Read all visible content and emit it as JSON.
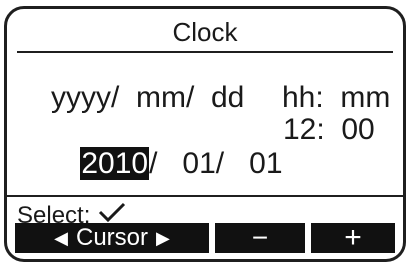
{
  "screen": {
    "title": "Clock",
    "header": {
      "date": "yyyy/  mm/  dd",
      "time": "hh:  mm"
    },
    "values": {
      "year": "2010",
      "date_rest": "/   01/   01",
      "time": "12:  00"
    },
    "select_label": "Select:",
    "softkeys": {
      "cursor_label": "Cursor",
      "cursor_left": "◀",
      "cursor_right": "▶",
      "minus": "−",
      "plus": "+"
    }
  }
}
